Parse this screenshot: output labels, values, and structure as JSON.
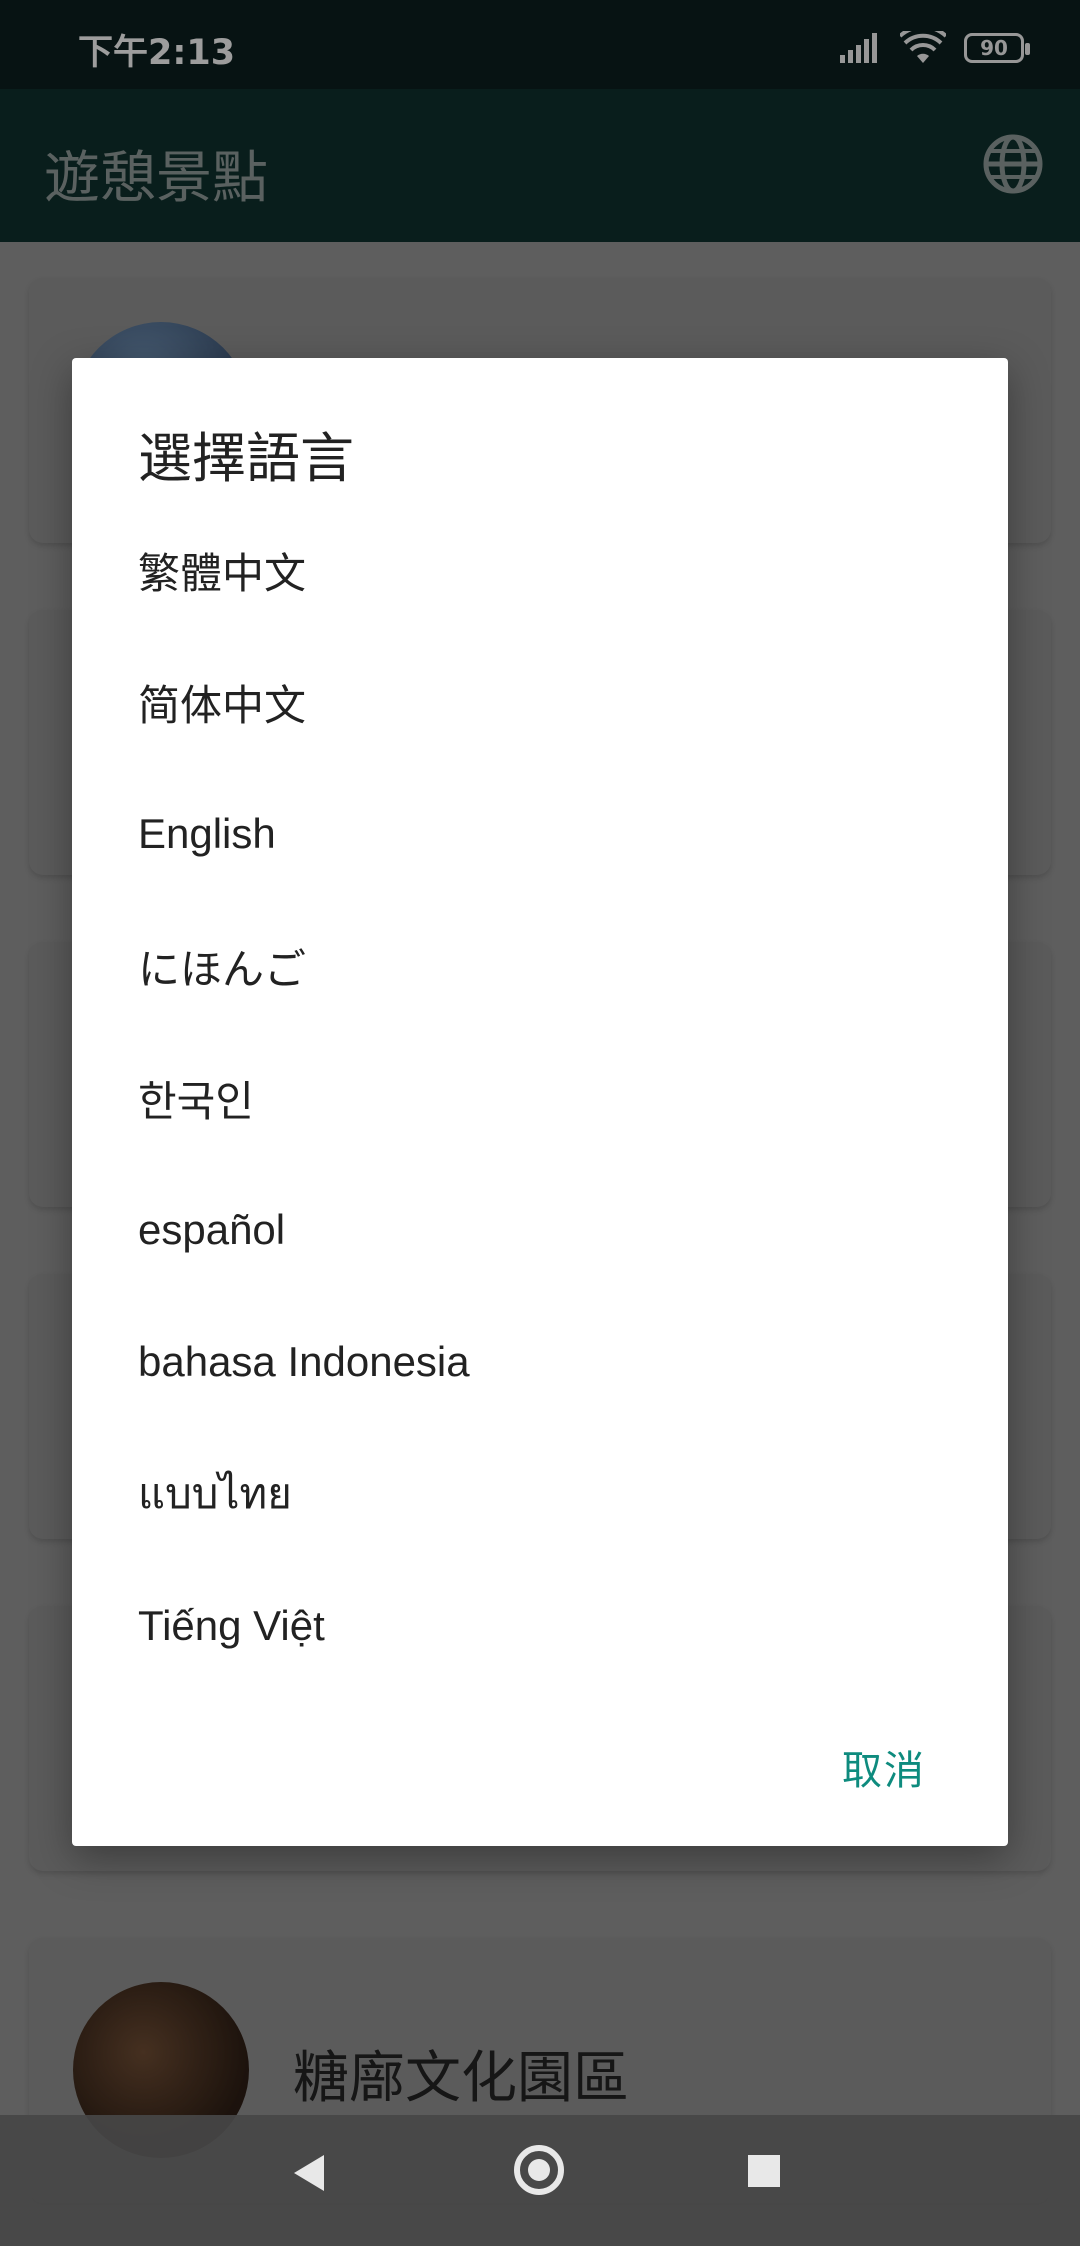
{
  "status_bar": {
    "time": "下午2:13",
    "battery": "90"
  },
  "app_bar": {
    "title": "遊憩景點"
  },
  "background_list": {
    "cards": [
      {
        "name": ""
      },
      {
        "name": ""
      },
      {
        "name": ""
      },
      {
        "name": ""
      },
      {
        "name": ""
      },
      {
        "name": "糖廍文化園區"
      }
    ]
  },
  "dialog": {
    "title": "選擇語言",
    "options": [
      "繁體中文",
      "简体中文",
      "English",
      "にほんご",
      "한국인",
      "español",
      "bahasa Indonesia",
      "แบบไทย",
      "Tiếng Việt"
    ],
    "cancel": "取消"
  },
  "colors": {
    "accent": "#0e8b7e",
    "app_bar": "#0f2f2c",
    "status_bar": "#0b1e1e"
  }
}
